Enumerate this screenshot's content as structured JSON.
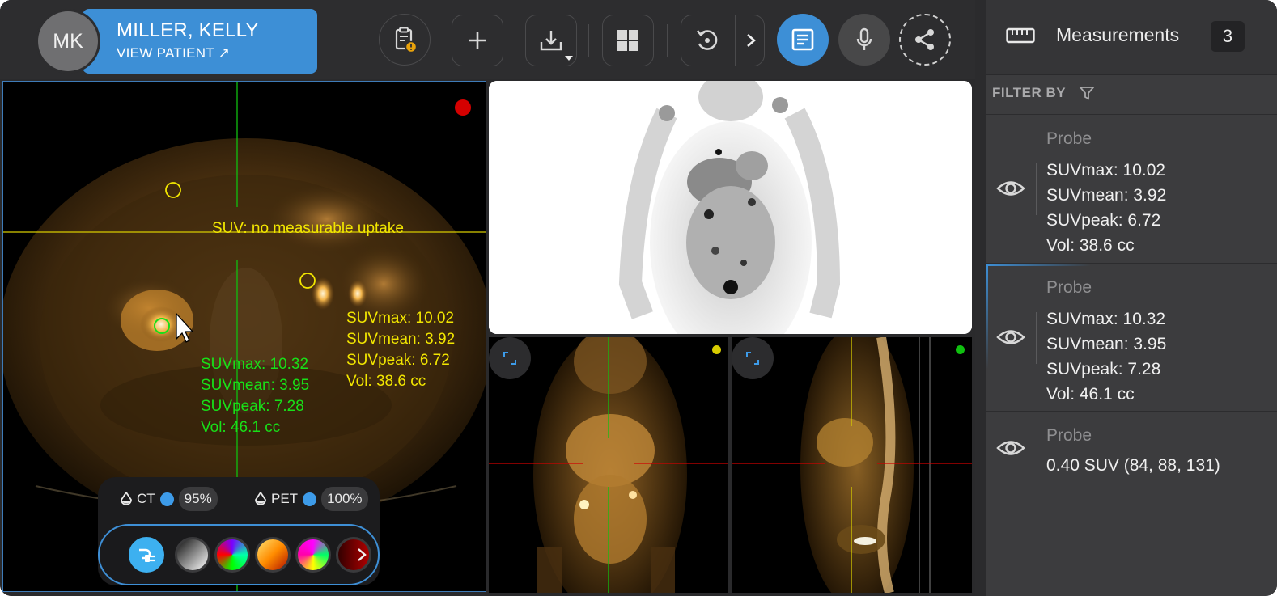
{
  "patient": {
    "initials": "MK",
    "name": "MILLER, KELLY",
    "view_patient": "VIEW PATIENT ↗"
  },
  "toolbar": {
    "icons": [
      "clipboard-warning-icon",
      "plus-icon",
      "download-icon",
      "layout-grid-icon",
      "rotate-icon",
      "chevron-right-icon",
      "report-icon",
      "microphone-icon",
      "share-icon"
    ]
  },
  "axial": {
    "no_uptake": "SUV: no measurable uptake",
    "yellow_stats": [
      "SUVmax: 10.02",
      "SUVmean: 3.92",
      "SUVpeak: 6.72",
      "Vol: 38.6 cc"
    ],
    "green_stats": [
      "SUVmax: 10.32",
      "SUVmean: 3.95",
      "SUVpeak: 7.28",
      "Vol: 46.1 cc"
    ]
  },
  "fusion": {
    "ct_label": "CT",
    "ct_opacity": "95%",
    "pet_label": "PET",
    "pet_opacity": "100%"
  },
  "measurements_panel": {
    "title": "Measurements",
    "count": "3",
    "filter_label": "FILTER BY",
    "items": [
      {
        "type": "Probe",
        "lines": [
          "SUVmax: 10.02",
          "SUVmean: 3.92",
          "SUVpeak: 6.72",
          "Vol: 38.6 cc"
        ]
      },
      {
        "type": "Probe",
        "lines": [
          "SUVmax: 10.32",
          "SUVmean: 3.95",
          "SUVpeak: 7.28",
          "Vol: 46.1 cc"
        ]
      },
      {
        "type": "Probe",
        "lines": [
          "0.40 SUV (84, 88, 131)"
        ]
      }
    ]
  },
  "colors": {
    "accent": "#3d8fd6",
    "probe_yellow": "#f2e600",
    "probe_green": "#18e018",
    "status_red": "#d40000"
  }
}
